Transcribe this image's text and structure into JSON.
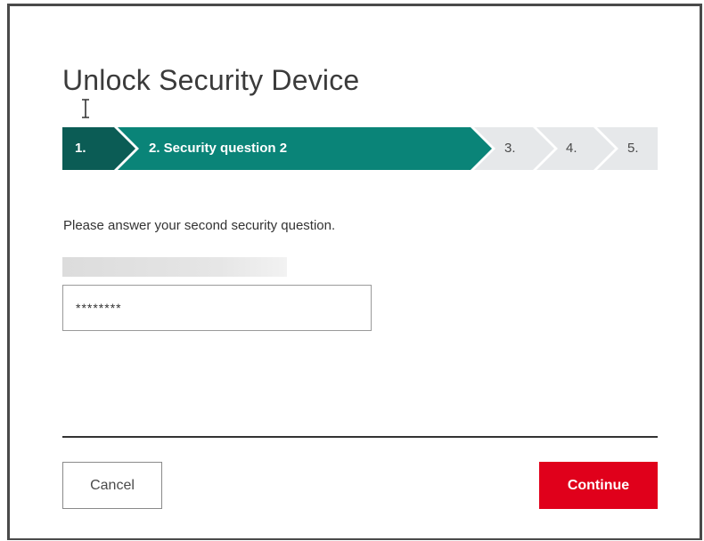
{
  "dialog": {
    "title": "Unlock Security Device"
  },
  "stepper": {
    "steps": [
      {
        "label": "1.",
        "state": "completed"
      },
      {
        "label": "2. Security question 2",
        "state": "active"
      },
      {
        "label": "3.",
        "state": "pending"
      },
      {
        "label": "4.",
        "state": "pending"
      },
      {
        "label": "5.",
        "state": "pending"
      }
    ],
    "colors": {
      "completed": "#0b5c55",
      "active": "#0a8478",
      "pending": "#e6e8ea"
    }
  },
  "form": {
    "instruction": "Please answer your second security question.",
    "answer_value": "********"
  },
  "footer": {
    "cancel_label": "Cancel",
    "continue_label": "Continue",
    "continue_color": "#e0001b"
  }
}
